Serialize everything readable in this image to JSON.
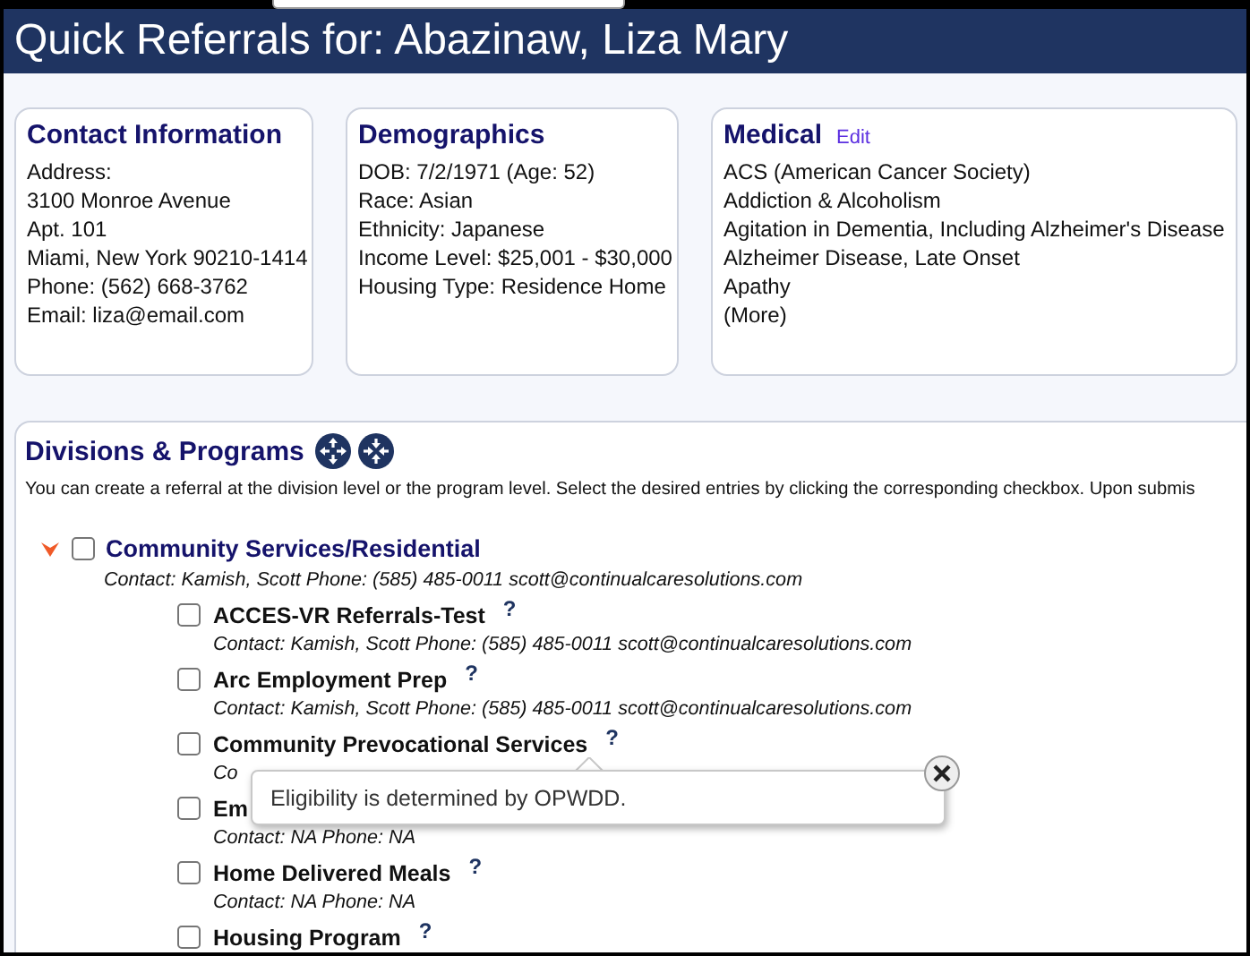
{
  "header": {
    "title": "Quick Referrals for: Abazinaw, Liza Mary"
  },
  "cards": [
    {
      "title": "Contact Information",
      "lines": [
        "Address:",
        "3100 Monroe Avenue",
        "Apt. 101",
        "Miami, New York 90210-1414",
        "Phone: (562) 668-3762",
        "Email: liza@email.com"
      ]
    },
    {
      "title": "Demographics",
      "lines": [
        "DOB: 7/2/1971 (Age: 52)",
        "Race: Asian",
        "Ethnicity: Japanese",
        "Income Level: $25,001 - $30,000",
        "Housing Type: Residence Home"
      ]
    },
    {
      "title": "Medical",
      "edit": "Edit",
      "lines": [
        "ACS (American Cancer Society)",
        "Addiction & Alcoholism",
        "Agitation in Dementia, Including Alzheimer's Disease",
        "Alzheimer Disease, Late Onset",
        "Apathy",
        "(More)"
      ]
    }
  ],
  "divisions": {
    "title": "Divisions & Programs",
    "description": "You can create a referral at the division level or the program level. Select the desired entries by clicking the corresponding checkbox. Upon submis",
    "items": [
      {
        "name": "Community Services/Residential",
        "contact": "Contact: Kamish, Scott Phone: (585) 485-0011 scott@continualcaresolutions.com",
        "expanded": true,
        "checked": false,
        "programs": [
          {
            "name": "ACCES-VR Referrals-Test",
            "help": "?",
            "contact": "Contact: Kamish, Scott Phone: (585) 485-0011 scott@continualcaresolutions.com",
            "checked": false
          },
          {
            "name": "Arc Employment Prep",
            "help": "?",
            "contact": "Contact: Kamish, Scott Phone: (585) 485-0011 scott@continualcaresolutions.com",
            "checked": false
          },
          {
            "name": "Community Prevocational Services",
            "help": "?",
            "contact": "Co",
            "checked": false
          },
          {
            "name": "Em",
            "contact": "Contact: NA Phone: NA",
            "checked": false
          },
          {
            "name": "Home Delivered Meals",
            "help": "?",
            "contact": "Contact: NA Phone: NA",
            "checked": false
          },
          {
            "name": "Housing Program",
            "help": "?",
            "checked": false
          }
        ]
      }
    ]
  },
  "popover": {
    "text": "Eligibility is determined by OPWDD."
  }
}
